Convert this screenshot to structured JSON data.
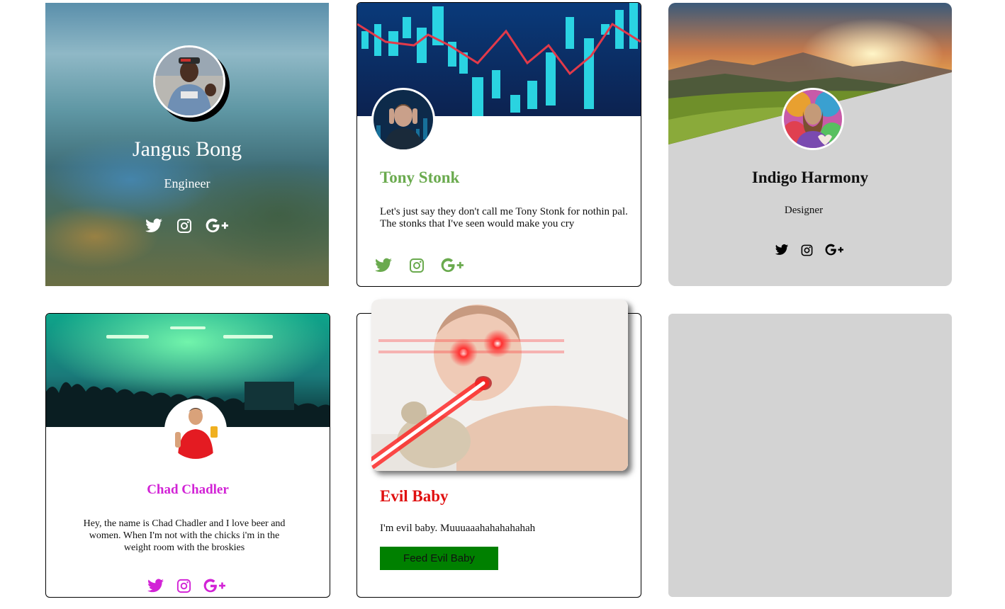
{
  "cards": [
    {
      "name": "Jangus Bong",
      "role": "Engineer"
    },
    {
      "name": "Tony Stonk",
      "bio": "Let's just say they don't call me Tony Stonk for nothin pal. The stonks that I've seen would make you cry"
    },
    {
      "name": "Indigo Harmony",
      "role": "Designer"
    },
    {
      "name": "Chad Chadler",
      "bio": "Hey, the name is Chad Chadler and I love beer and women. When I'm not with the chicks i'm in the weight room with the broskies"
    },
    {
      "name": "Evil Baby",
      "bio": "I'm evil baby. Muuuaaahahahahahah",
      "button_label": "Feed Evil Baby"
    }
  ],
  "social_icons": [
    "twitter-icon",
    "instagram-icon",
    "google-plus-icon"
  ],
  "colors": {
    "tony_accent": "#6aaa4e",
    "chad_accent": "#d223d6",
    "evil_accent": "#e01010",
    "feed_button": "#008000",
    "panel_gray": "#d3d3d3"
  }
}
